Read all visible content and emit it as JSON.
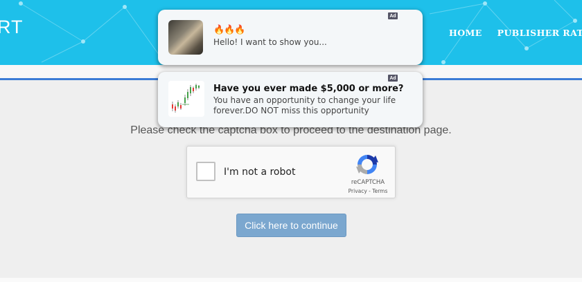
{
  "header": {
    "logo_text": "RT",
    "nav": [
      "HOME",
      "PUBLISHER RATES"
    ],
    "bg_color": "#1ec0ea"
  },
  "main": {
    "prompt": "Please check the captcha box to proceed to the destination page.",
    "captcha": {
      "label": "I'm not a robot",
      "brand": "reCAPTCHA",
      "links": "Privacy - Terms",
      "checked": false
    },
    "continue_button": "Click here to continue"
  },
  "ads": [
    {
      "badge": "Ad",
      "title": "🔥🔥🔥",
      "body": "Hello! I want to show you..."
    },
    {
      "badge": "Ad",
      "title": "Have you ever made $5,000 or more?",
      "body": "You have an opportunity to change your life forever.DO NOT miss this opportunity"
    }
  ]
}
